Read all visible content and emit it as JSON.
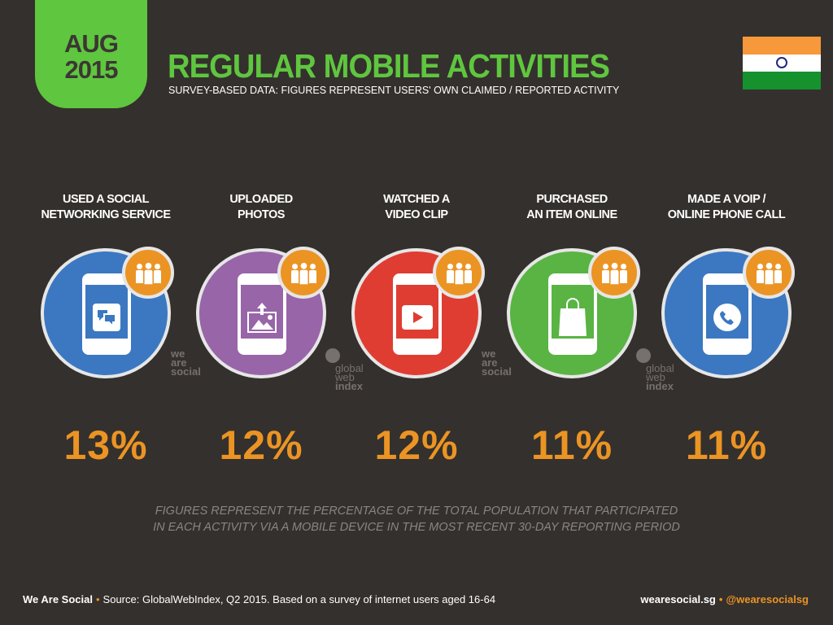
{
  "header": {
    "month": "AUG",
    "year": "2015",
    "title": "REGULAR MOBILE ACTIVITIES",
    "subtitle": "SURVEY-BASED DATA: FIGURES REPRESENT USERS' OWN CLAIMED / REPORTED ACTIVITY",
    "flag": "india-flag",
    "accent": "#5fc63f"
  },
  "activities": [
    {
      "label1": "USED A SOCIAL",
      "label2": "NETWORKING SERVICE",
      "value": "13%",
      "color": "#3b78c1",
      "icon": "chat-bubbles-icon"
    },
    {
      "label1": "UPLOADED",
      "label2": "PHOTOS",
      "value": "12%",
      "color": "#9865a8",
      "icon": "photo-upload-icon"
    },
    {
      "label1": "WATCHED A",
      "label2": "VIDEO CLIP",
      "value": "12%",
      "color": "#e03d32",
      "icon": "play-icon"
    },
    {
      "label1": "PURCHASED",
      "label2": "AN ITEM ONLINE",
      "value": "11%",
      "color": "#59b443",
      "icon": "shopping-bag-icon"
    },
    {
      "label1": "MADE A VOIP /",
      "label2": "ONLINE PHONE CALL",
      "value": "11%",
      "color": "#3b78c1",
      "icon": "phone-call-icon"
    }
  ],
  "watermarks": {
    "wearesocial": [
      "we",
      "are",
      "social"
    ],
    "gwi": [
      "global",
      "web",
      "index"
    ]
  },
  "note": {
    "line1": "FIGURES REPRESENT THE PERCENTAGE OF THE TOTAL POPULATION THAT PARTICIPATED",
    "line2": "IN EACH ACTIVITY VIA A MOBILE DEVICE IN THE MOST RECENT 30-DAY REPORTING PERIOD"
  },
  "footer": {
    "brand": "We Are Social",
    "source": "Source: GlobalWebIndex, Q2 2015. Based on a survey of internet users aged 16-64",
    "site": "wearesocial.sg",
    "handle": "@wearesocialsg"
  },
  "colors": {
    "badge": "#eb9424",
    "value": "#eb9424",
    "background": "#34302d"
  }
}
